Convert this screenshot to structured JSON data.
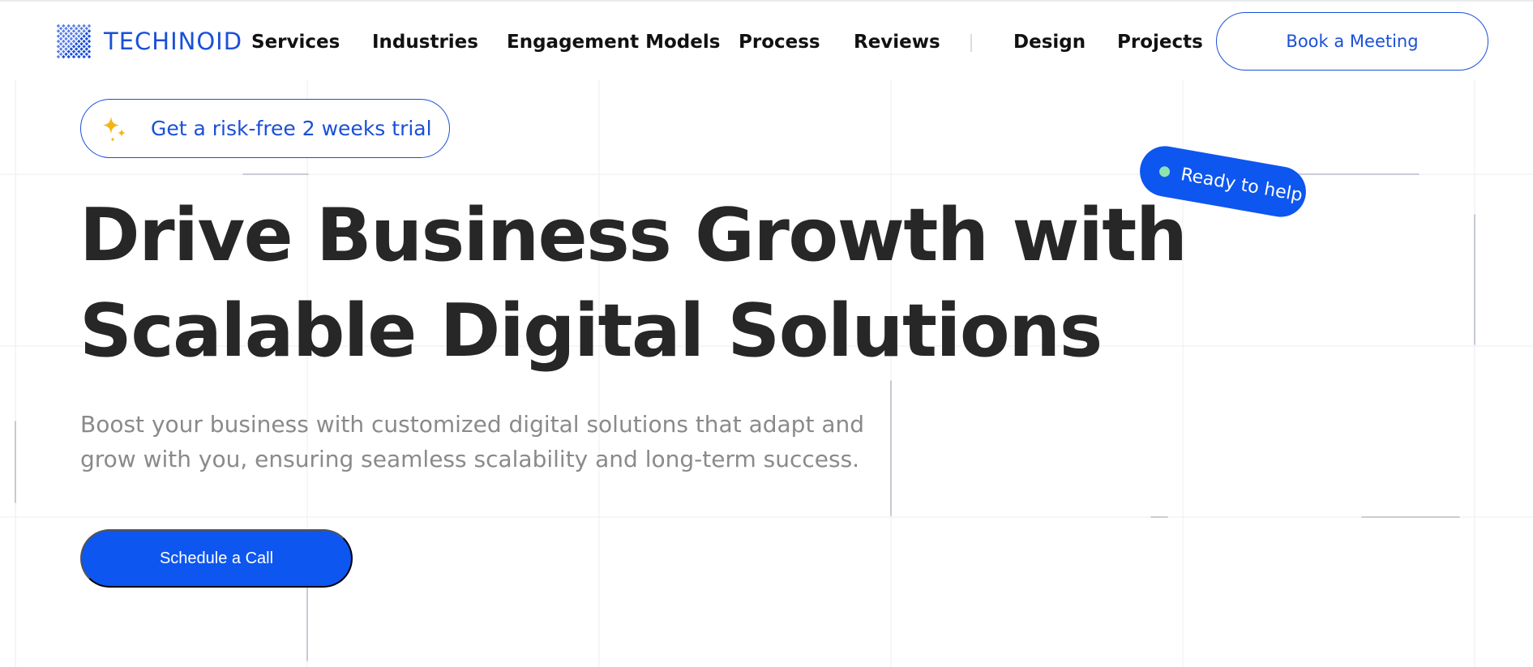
{
  "brand": {
    "name": "TECHINOID",
    "logo_icon": "diamond-dots-logo-icon",
    "accent": "#1a4fd8",
    "button_blue": "#0d56ef"
  },
  "nav": {
    "items": [
      "Services",
      "Industries",
      "Engagement Models",
      "Process",
      "Reviews",
      "Design",
      "Projects"
    ],
    "meeting_button": "Book a Meeting"
  },
  "hero": {
    "trial_pill": "Get a risk-free 2 weeks trial",
    "trial_icon": "sparkle-icon",
    "badge": "Ready to help",
    "title_lines": [
      "Drive Business Growth with",
      "Scalable Digital Solutions"
    ],
    "subtitle_lines": [
      "Boost your business with customized digital solutions that adapt and",
      "grow with you, ensuring seamless scalability and long-term success."
    ],
    "cta": "Schedule a Call"
  }
}
